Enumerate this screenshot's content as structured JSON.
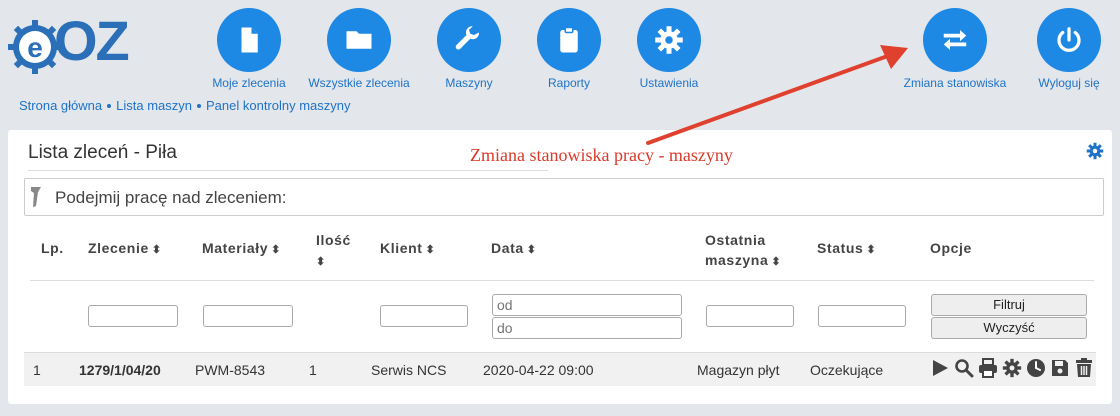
{
  "logo": {
    "text": "OZ",
    "letter": "e"
  },
  "nav": [
    {
      "label": "Moje zlecenia",
      "icon": "document-icon"
    },
    {
      "label": "Wszystkie zlecenia",
      "icon": "folder-icon"
    },
    {
      "label": "Maszyny",
      "icon": "wrench-icon"
    },
    {
      "label": "Raporty",
      "icon": "clipboard-icon"
    },
    {
      "label": "Ustawienia",
      "icon": "gear-icon"
    },
    {
      "label": "Zmiana stanowiska",
      "icon": "swap-arrows-icon"
    },
    {
      "label": "Wyloguj się",
      "icon": "power-icon"
    }
  ],
  "breadcrumb": [
    "Strona główna",
    "Lista maszyn",
    "Panel kontrolny maszyny"
  ],
  "page_title": "Lista zleceń - Piła",
  "annotation": "Zmiana stanowiska pracy - maszyny",
  "colors": {
    "accent": "#1e88e5",
    "annotation": "#d93a2b"
  },
  "scan": {
    "label": "Podejmij pracę nad zleceniem:"
  },
  "table": {
    "headers": {
      "lp": "Lp.",
      "zlecenie": "Zlecenie",
      "materialy": "Materiały",
      "ilosc": "Ilość",
      "klient": "Klient",
      "data": "Data",
      "ostatnia_1": "Ostatnia",
      "ostatnia_2": "maszyna",
      "status": "Status",
      "opcje": "Opcje"
    },
    "sort_glyph": "⬍",
    "filters": {
      "date_from_placeholder": "od",
      "date_to_placeholder": "do",
      "filter_button": "Filtruj",
      "clear_button": "Wyczyść"
    },
    "rows": [
      {
        "lp": "1",
        "zlecenie": "1279/1/04/20",
        "materialy": "PWM-8543",
        "ilosc": "1",
        "klient": "Serwis NCS",
        "data": "2020-04-22 09:00",
        "ostatnia_maszyna": "Magazyn płyt",
        "status": "Oczekujące"
      }
    ],
    "row_actions": [
      "play-icon",
      "search-icon",
      "print-icon",
      "gear-icon",
      "clock-icon",
      "save-icon",
      "trash-icon"
    ]
  }
}
